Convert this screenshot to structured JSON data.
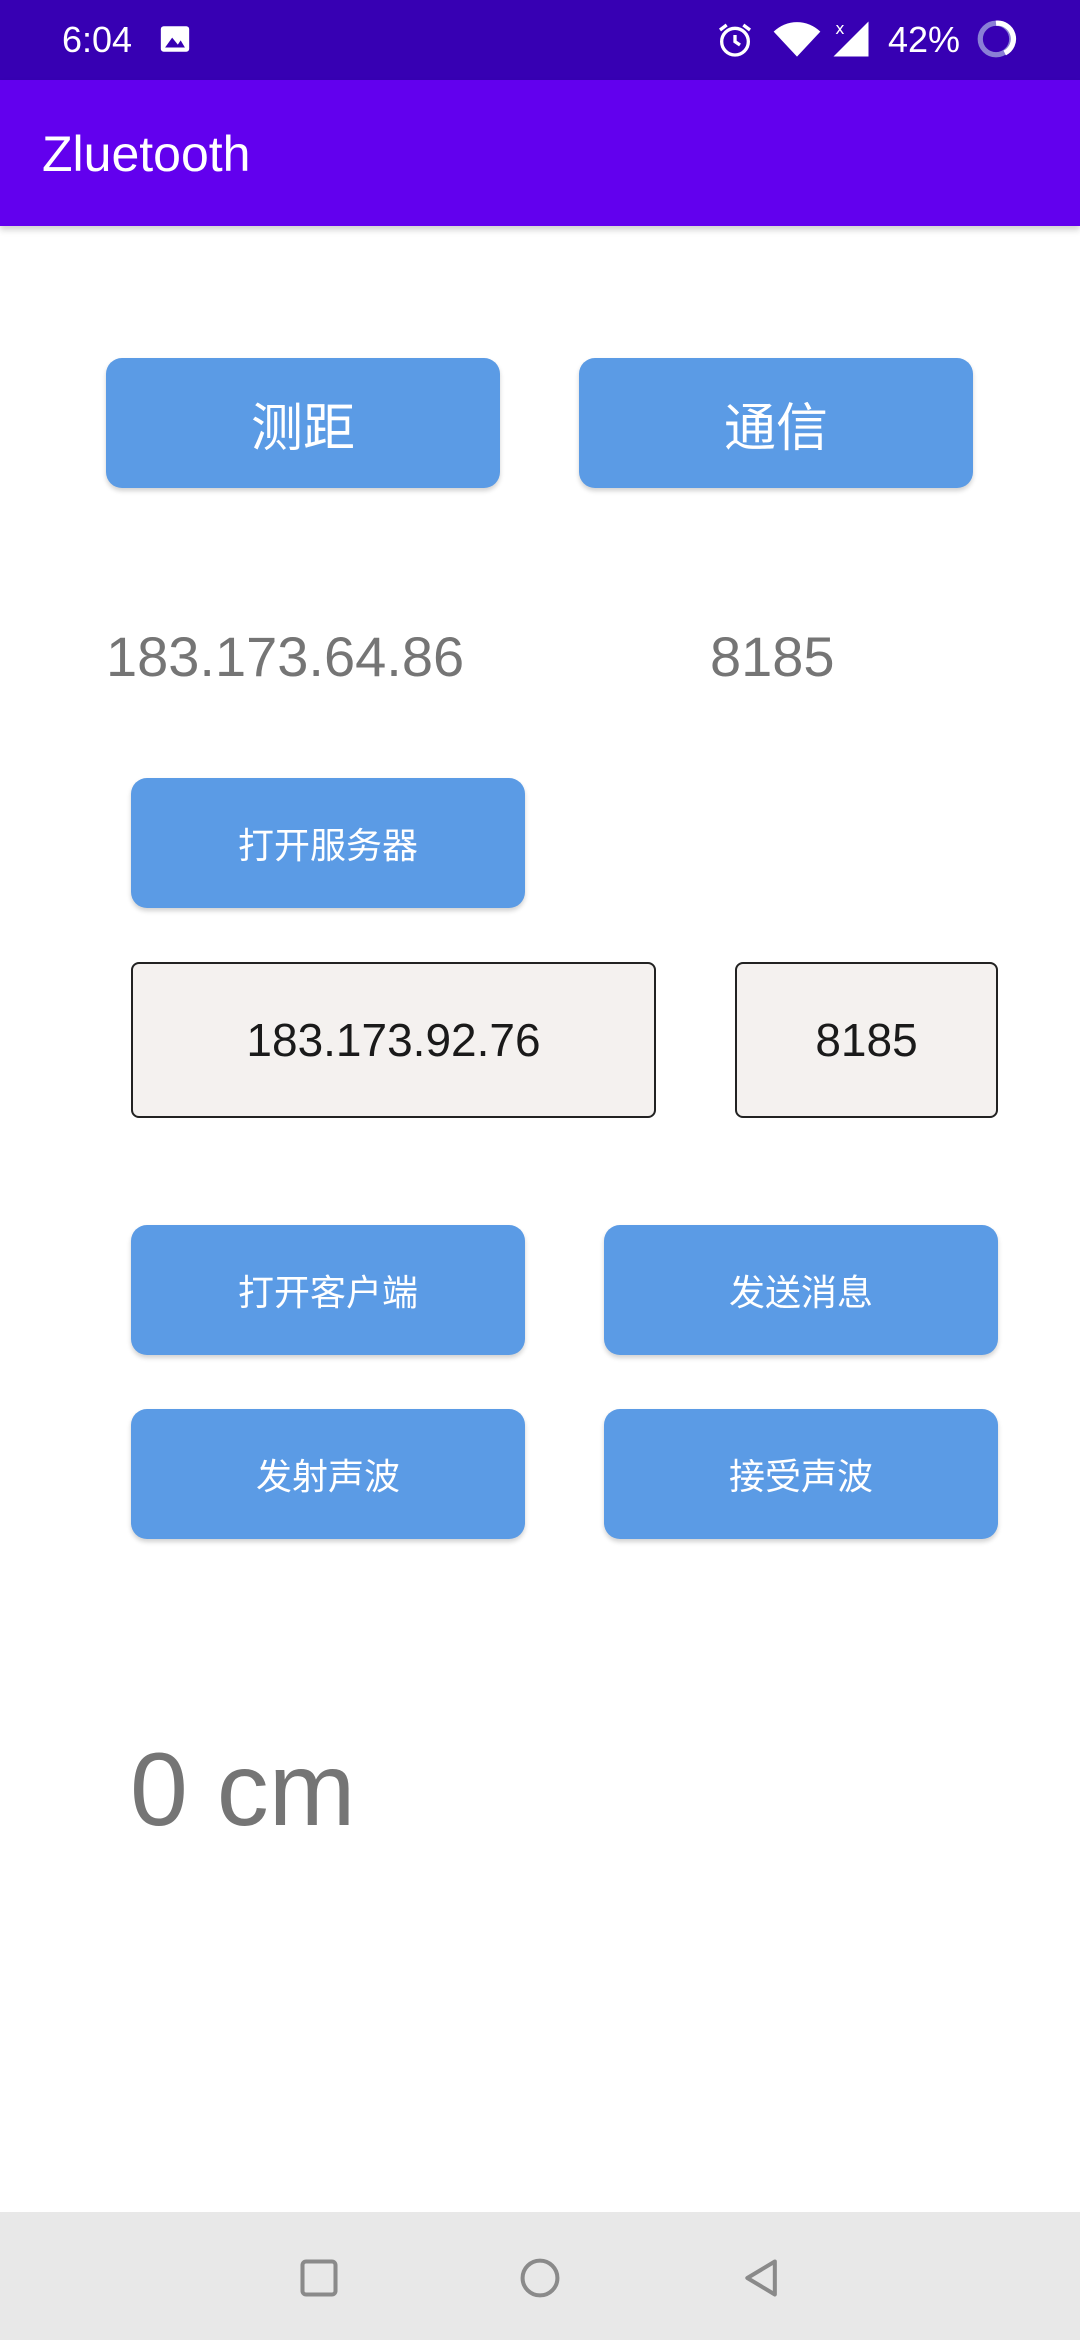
{
  "status_bar": {
    "time": "6:04",
    "battery": "42%",
    "icons": [
      "image-icon",
      "alarm-icon",
      "wifi-icon",
      "signal-icon",
      "battery-icon"
    ]
  },
  "app_bar": {
    "title": "Zluetooth"
  },
  "mode_buttons": {
    "ranging": "测距",
    "communication": "通信"
  },
  "local": {
    "ip": "183.173.64.86",
    "port": "8185"
  },
  "server": {
    "open_label": "打开服务器"
  },
  "client": {
    "ip_value": "183.173.92.76",
    "port_value": "8185",
    "open_label": "打开客户端",
    "send_label": "发送消息"
  },
  "sound": {
    "emit_label": "发射声波",
    "receive_label": "接受声波"
  },
  "result": {
    "distance": "0 cm"
  },
  "colors": {
    "status_bar": "#3700b3",
    "app_bar": "#6200ee",
    "button": "#5b9be5",
    "field_bg": "#f4f1ef",
    "muted_text": "#757575"
  }
}
